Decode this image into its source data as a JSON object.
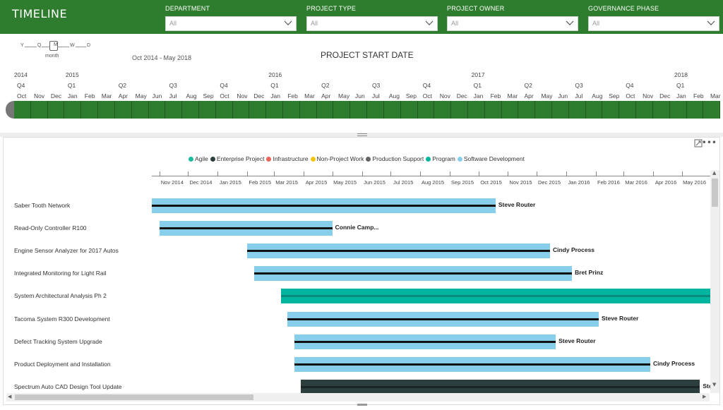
{
  "header": {
    "title": "TIMELINE",
    "filters": [
      {
        "label": "DEPARTMENT",
        "value": "All"
      },
      {
        "label": "PROJECT TYPE",
        "value": "All"
      },
      {
        "label": "PROJECT OWNER",
        "value": "All"
      },
      {
        "label": "GOVERNANCE PHASE",
        "value": "All"
      }
    ],
    "chevron_icon": "chevron-down-icon"
  },
  "timeline": {
    "granularity": {
      "letters": [
        "Y",
        "Q",
        "M",
        "W",
        "D"
      ],
      "selected": "M",
      "caption": "month"
    },
    "date_range": "Oct 2014 - May 2018",
    "title": "PROJECT START DATE",
    "years": [
      "2014",
      "2015",
      "2016",
      "2017",
      "2018"
    ],
    "quarters": [
      "Q4",
      "Q1",
      "Q2",
      "Q3",
      "Q4",
      "Q1",
      "Q2",
      "Q3",
      "Q4",
      "Q1",
      "Q2",
      "Q3",
      "Q4",
      "Q1"
    ],
    "months": [
      "Oct",
      "Nov",
      "Dec",
      "Jan",
      "Feb",
      "Mar",
      "Apr",
      "May",
      "Jun",
      "Jul",
      "Aug",
      "Sep",
      "Oct",
      "Nov",
      "Dec",
      "Jan",
      "Feb",
      "Mar",
      "Apr",
      "May",
      "Jun",
      "Jul",
      "Aug",
      "Sep",
      "Oct",
      "Nov",
      "Dec",
      "Jan",
      "Feb",
      "Mar",
      "Apr",
      "May",
      "Jun",
      "Jul",
      "Aug",
      "Sep",
      "Oct",
      "Nov",
      "Dec",
      "Jan",
      "Feb",
      "Mar"
    ],
    "bar_color": "#2e7d2e"
  },
  "gantt": {
    "legend": [
      {
        "label": "Agile",
        "color": "#1abc9c"
      },
      {
        "label": "Enterprise Project",
        "color": "#2c3e3e"
      },
      {
        "label": "Infrastructure",
        "color": "#e8675a"
      },
      {
        "label": "Non-Project Work",
        "color": "#f1c40f"
      },
      {
        "label": "Production Support",
        "color": "#666666"
      },
      {
        "label": "Program",
        "color": "#00b5a0"
      },
      {
        "label": "Software Development",
        "color": "#87ceeb"
      }
    ],
    "axis_labels": [
      "Nov 2014",
      "Dec 2014",
      "Jan 2015",
      "Feb 2015",
      "Mar 2015",
      "Apr 2015",
      "May 2015",
      "Jun 2015",
      "Jul 2015",
      "Aug 2015",
      "Sep 2015",
      "Oct 2015",
      "Nov 2015",
      "Dec 2015",
      "Jan 2016",
      "Feb 2016",
      "Mar 2016",
      "Apr 2016",
      "May 2016"
    ],
    "tasks": [
      {
        "name": "Saber Tooth Network",
        "owner": "Steve Router",
        "type": "Software Development",
        "start": "2014-10-24",
        "end": "2015-10-19"
      },
      {
        "name": "Read-Only Controller R100",
        "owner": "Connie Camp...",
        "type": "Software Development",
        "start": "2014-11-01",
        "end": "2015-05-01"
      },
      {
        "name": "Engine Sensor Analyzer for 2017 Autos",
        "owner": "Cindy Process",
        "type": "Software Development",
        "start": "2015-02-01",
        "end": "2015-12-15"
      },
      {
        "name": "Integrated Monitoring for Light Rail",
        "owner": "Bret Prinz",
        "type": "Software Development",
        "start": "2015-02-08",
        "end": "2016-01-07"
      },
      {
        "name": "System Architectural Analysis Ph 2",
        "owner": "",
        "type": "Program",
        "start": "2015-03-08",
        "end": "2016-06-01"
      },
      {
        "name": "Tacoma System R300 Development",
        "owner": "Steve Router",
        "type": "Software Development",
        "start": "2015-03-15",
        "end": "2016-02-04"
      },
      {
        "name": "Defect Tracking System Upgrade",
        "owner": "Steve Router",
        "type": "Software Development",
        "start": "2015-03-22",
        "end": "2015-12-21"
      },
      {
        "name": "Product Deployment and Installation",
        "owner": "Cindy Process",
        "type": "Software Development",
        "start": "2015-03-22",
        "end": "2016-03-29"
      },
      {
        "name": "Spectrum Auto CAD Design Tool Update",
        "owner": "Steve Router",
        "type": "Enterprise Project",
        "start": "2015-03-29",
        "end": "2016-05-20"
      }
    ]
  }
}
